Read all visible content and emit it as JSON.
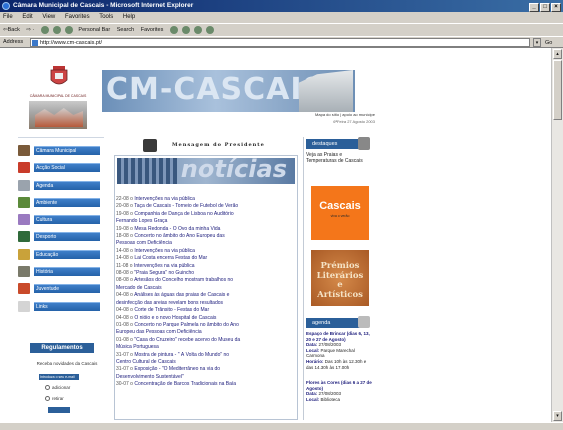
{
  "window": {
    "title": "Câmara Municipal de Cascais - Microsoft Internet Explorer",
    "buttons": [
      "_",
      "□",
      "×"
    ]
  },
  "menubar": [
    "File",
    "Edit",
    "View",
    "Favorites",
    "Tools",
    "Help"
  ],
  "toolbar": {
    "back": "⇦Back",
    "personal_bar": "Personal Bar",
    "search": "Search",
    "favorites": "Favorites"
  },
  "address": {
    "label": "Address",
    "url": "http://www.cm-cascais.pt/",
    "go": "Go"
  },
  "header": {
    "municipality": "CÂMARA MUNICIPAL DE CASCAIS",
    "banner_text": "CM-CASCAIS",
    "site_links": "Mapa do sítio | apoio ao munícipe",
    "date": "6ªFeira 27 Agosto 2003"
  },
  "nav": [
    {
      "label": "Câmara Municipal",
      "color": "#7a5a3a"
    },
    {
      "label": "Acção Social",
      "color": "#c93c2a"
    },
    {
      "label": "Agenda",
      "color": "#9aa3ad"
    },
    {
      "label": "Ambiente",
      "color": "#5b8a3a"
    },
    {
      "label": "Cultura",
      "color": "#9a7ac0"
    },
    {
      "label": "Desporto",
      "color": "#2f6a3a"
    },
    {
      "label": "Educação",
      "color": "#c9a23a"
    },
    {
      "label": "História",
      "color": "#7a7a6a"
    },
    {
      "label": "Juventude",
      "color": "#c94a2a"
    },
    {
      "label": "Links",
      "color": "#d4d4d4"
    }
  ],
  "newsletter": {
    "heading": "Regulamentos",
    "text": "Receba novidades da Cascais",
    "input_placeholder": "Introduza o seu e-mail",
    "opt_add": "adicionar",
    "opt_remove": "retirar"
  },
  "center": {
    "message_title": "Mensagem do Presidente",
    "banner_word": "notícias",
    "news": [
      {
        "date": "22-08",
        "text": "Intervenções na via pública"
      },
      {
        "date": "20-08",
        "text": "Taça de Cascais - Torneio de Futebol de Verão"
      },
      {
        "date": "19-08",
        "text": "Companhia de Dança de Lisboa no Auditório"
      },
      {
        "date": "",
        "text": "Fernando Lopes Graça"
      },
      {
        "date": "19-08",
        "text": "Mesa Redonda - O Ovo da minha Vida"
      },
      {
        "date": "18-08",
        "text": "Concerto no âmbito do Ano Europeu das"
      },
      {
        "date": "",
        "text": "Pessoas com Deficiência"
      },
      {
        "date": "14-08",
        "text": "Intervenções na via pública"
      },
      {
        "date": "14-08",
        "text": "Lai Costa encerra Festas do Mar"
      },
      {
        "date": "11-08",
        "text": "Intervenções na via pública"
      },
      {
        "date": "08-08",
        "text": "\"Praia Segura\" no Guincho"
      },
      {
        "date": "08-08",
        "text": "Artesãos do Concelho mostram trabalhos no"
      },
      {
        "date": "",
        "text": "Mercado de Cascais"
      },
      {
        "date": "04-08",
        "text": "Análises às águas das praias de Cascais e"
      },
      {
        "date": "",
        "text": "desinfecção das areias revelam bons resultados"
      },
      {
        "date": "04-08",
        "text": "Corte de Trânsito - Festas do Mar"
      },
      {
        "date": "04-08",
        "text": "O nióio e o novo Hospital de Cascais"
      },
      {
        "date": "01-08",
        "text": "Concerto no Parque Palmela no âmbito do Ano"
      },
      {
        "date": "",
        "text": "Europeu das Pessoas com Deficiência"
      },
      {
        "date": "01-08",
        "text": "\"Casa do Cruzeiro\" recebe acervo do Museu da"
      },
      {
        "date": "",
        "text": "Música Portuguesa"
      },
      {
        "date": "31-07",
        "text": "Mostra de pintura - \" À Volta do Mundo\" no"
      },
      {
        "date": "",
        "text": "Centro Cultural de Cascais"
      },
      {
        "date": "31-07",
        "text": "Exposição - \"O Mediterrâneo na via do"
      },
      {
        "date": "",
        "text": "Desenvolvimento Sustentável\""
      },
      {
        "date": "30-07",
        "text": "Concentração de Barcos Tradicionais na Baía"
      }
    ]
  },
  "right": {
    "destaques": "destaques",
    "veja": "Veja as Praias e Temperaturas de Cascais",
    "cascais_title": "Cascais",
    "cascais_sub": "viva o verão",
    "premios": [
      "Prémios",
      "Literários",
      "e",
      "Artísticos"
    ],
    "agenda": "agenda",
    "agenda_items": [
      {
        "title": "Espaço de Brincar (dias 6, 13, 20 e 27 de Agosto)",
        "data": "27/08/2003",
        "local": "Parque Marechal Carmona",
        "horario": "Das 10h às 12.30h e das 14.30h às 17.00h"
      },
      {
        "title": "Flores às Cores (dias 6 a 27 de Agosto)",
        "data": "27/08/2003",
        "local": "Biblioteca"
      }
    ]
  }
}
